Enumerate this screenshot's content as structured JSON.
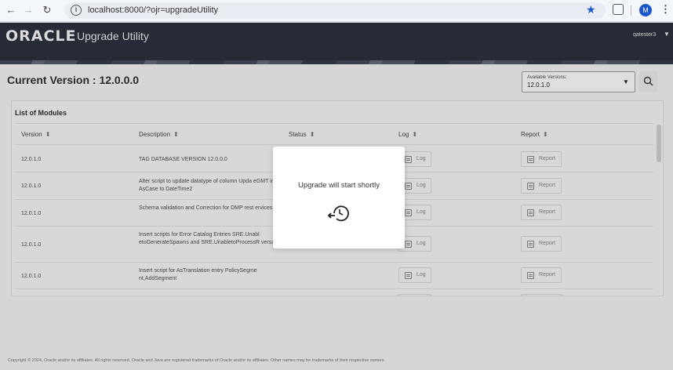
{
  "browser": {
    "url": "localhost:8000/?ojr=upgradeUtility",
    "profile_initial": "M"
  },
  "header": {
    "brand": "ORACLE",
    "app_title": "Upgrade Utility",
    "user": "qatester3"
  },
  "page": {
    "current_version": "Current Version : 12.0.0.0",
    "versions_select": {
      "label": "Available Versions:",
      "value": "12.0.1.0"
    }
  },
  "modules": {
    "title": "List of Modules",
    "columns": [
      "Version",
      "Description",
      "Status",
      "Log",
      "Report"
    ],
    "log_label": "Log",
    "report_label": "Report",
    "rows": [
      {
        "version": "12.0.1.0",
        "description": "TAG DATABASE VERSION 12.0.0.0"
      },
      {
        "version": "12.0.1.0",
        "description": "Alter script to update datatype of column Upda eGMT in AsCase to DateTime2"
      },
      {
        "version": "12.0.1.0",
        "description": "Schema validation and Correction for DMP rest ervices"
      },
      {
        "version": "12.0.1.0",
        "description": "Insert scripts for Error Catalog Entries SRE.Unabl etoGenerateSpawns and SRE.UnabletoProcessR versal"
      },
      {
        "version": "12.0.1.0",
        "description": "Insert script for AsTranslation entry PolicySegme nt,AddSegment"
      }
    ]
  },
  "modal": {
    "message": "Upgrade will start shortly"
  },
  "footer": {
    "text": "Copyright © 2024, Oracle and/or its affiliates. All rights reserved. Oracle and Java are registered trademarks of Oracle and/or its affiliates. Other names may be trademarks of their respective owners."
  },
  "colors": {
    "header_bg": "#262b35",
    "overlay_bg": "#d6d6d6",
    "accent": "#1a57c9"
  }
}
